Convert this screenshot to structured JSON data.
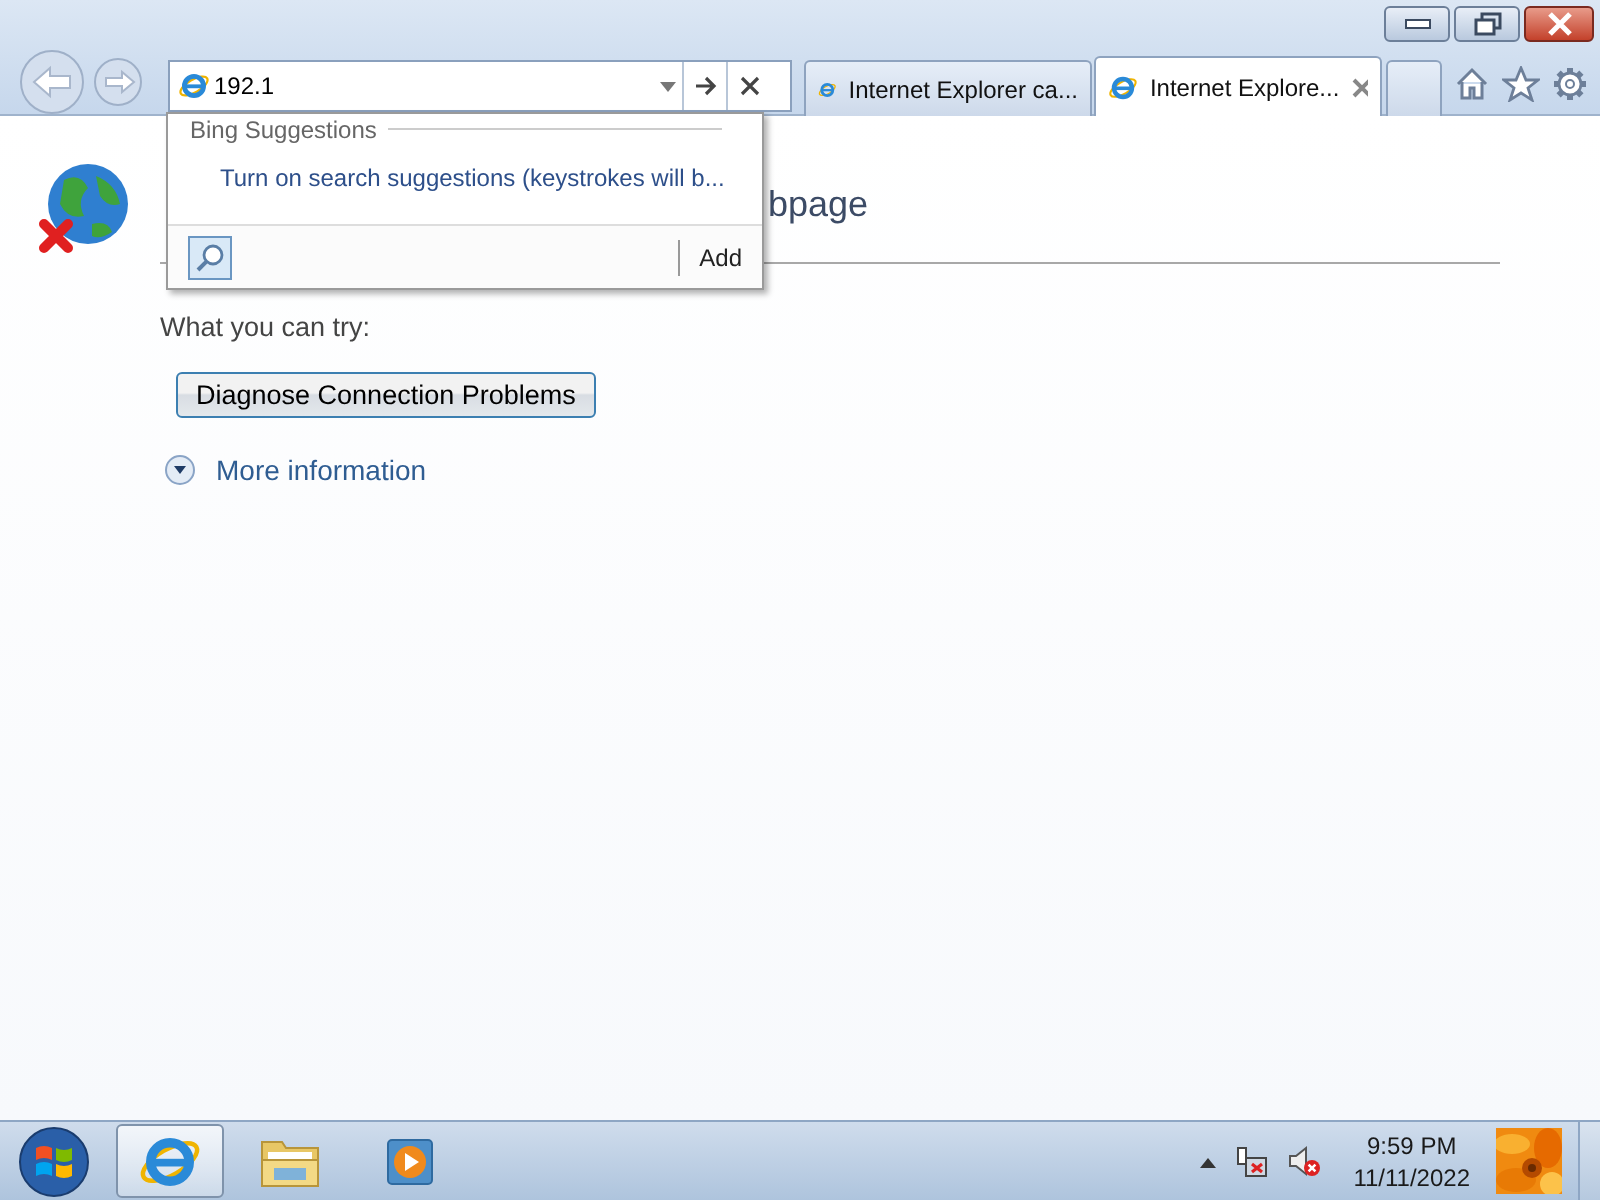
{
  "address_bar": {
    "value": "192.1"
  },
  "tabs": [
    {
      "label": "Internet Explorer ca...",
      "selected": false
    },
    {
      "label": "Internet Explore...",
      "selected": true
    }
  ],
  "suggestions": {
    "header": "Bing Suggestions",
    "items": [
      "Turn on search suggestions (keystrokes will b..."
    ],
    "add_label": "Add"
  },
  "page": {
    "heading": "bpage",
    "prompt": "What you can try:",
    "button": "Diagnose Connection Problems",
    "more_info": {
      "label": "More information",
      "expanded": false
    }
  },
  "taskbar": {
    "items": [
      {
        "kind": "browser",
        "selected": true
      },
      {
        "kind": "folder",
        "selected": false
      },
      {
        "kind": "media",
        "selected": false
      }
    ],
    "clock": {
      "time": "9:59 PM",
      "date": "11/11/2022"
    }
  }
}
